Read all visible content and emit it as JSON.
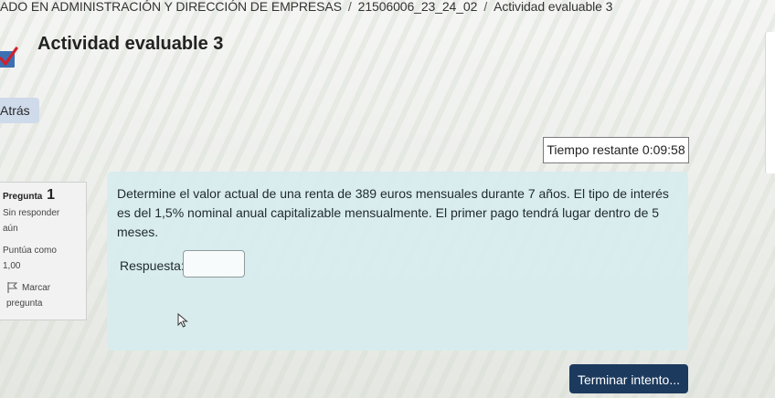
{
  "breadcrumb": {
    "course": "ADO EN ADMINISTRACIÓN Y DIRECCIÓN DE EMPRESAS",
    "group": "21506006_23_24_02",
    "activity": "Actividad evaluable 3",
    "separator": "/"
  },
  "page": {
    "title": "Actividad evaluable 3",
    "icon": "quiz-check-icon"
  },
  "nav": {
    "back_label": "Atrás"
  },
  "timer": {
    "text": "Tiempo restante 0:09:58"
  },
  "question": {
    "label": "Pregunta",
    "number": "1",
    "status_line1": "Sin responder",
    "status_line2": "aún",
    "score_line1": "Puntúa como",
    "score_line2": "1,00",
    "flag_line1": "Marcar",
    "flag_line2": "pregunta",
    "text": "Determine el valor actual de una renta de 389 euros mensuales durante 7 años. El tipo de interés es del 1,5% nominal anual capitalizable mensualmente. El primer pago tendrá lugar dentro de 5 meses.",
    "answer_label": "Respuesta:",
    "answer_value": ""
  },
  "actions": {
    "finish_label": "Terminar intento..."
  },
  "colors": {
    "question_bg": "#d7ecee",
    "finish_button": "#1c3a5e",
    "back_button": "#cfdaea"
  }
}
